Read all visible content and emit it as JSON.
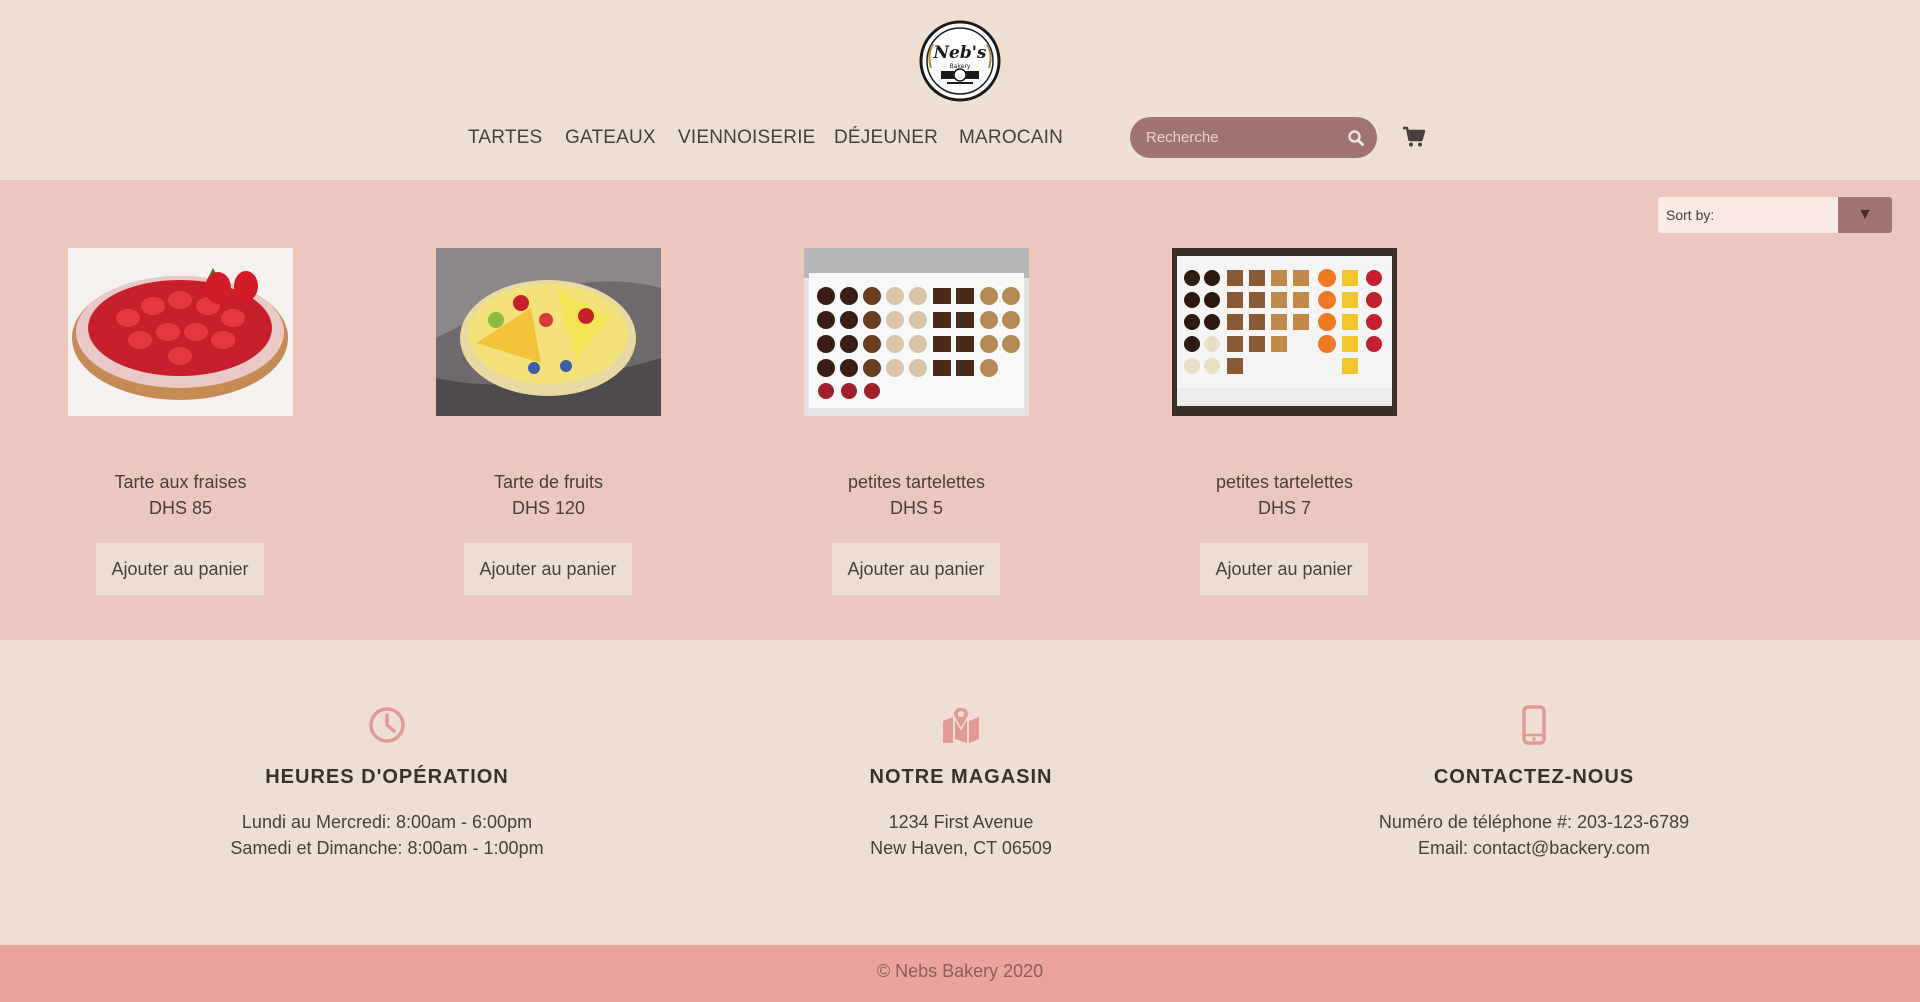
{
  "header": {
    "logo_text": "Neb's Bakery",
    "nav": [
      {
        "label": "TARTES"
      },
      {
        "label": "GATEAUX"
      },
      {
        "label": "VIENNOISERIE"
      },
      {
        "label": "DÉJEUNER"
      },
      {
        "label": "MAROCAIN"
      }
    ],
    "search": {
      "placeholder": "Recherche",
      "value": ""
    },
    "icons": {
      "search": "search-icon",
      "cart": "cart-icon"
    }
  },
  "sort": {
    "label": "Sort by:",
    "arrow": "▼"
  },
  "products": [
    {
      "name": "Tarte aux fraises",
      "price": "DHS 85",
      "button": "Ajouter au panier",
      "image": "strawberry-tart"
    },
    {
      "name": "Tarte de fruits",
      "price": "DHS 120",
      "button": "Ajouter au panier",
      "image": "fruit-tart"
    },
    {
      "name": "petites tartelettes",
      "price": "DHS 5",
      "button": "Ajouter au panier",
      "image": "small-tartlets-tray"
    },
    {
      "name": "petites tartelettes",
      "price": "DHS 7",
      "button": "Ajouter au panier",
      "image": "small-tartlets-tray-2"
    }
  ],
  "info": [
    {
      "icon": "clock-icon",
      "title": "HEURES D'OPÉRATION",
      "line1": "Lundi au Mercredi: 8:00am - 6:00pm",
      "line2": "Samedi et Dimanche: 8:00am - 1:00pm"
    },
    {
      "icon": "map-pin-icon",
      "title": "NOTRE MAGASIN",
      "line1": "1234 First Avenue",
      "line2": "New Haven, CT 06509"
    },
    {
      "icon": "phone-icon",
      "title": "CONTACTEZ-NOUS",
      "line1": "Numéro de téléphone #: 203-123-6789",
      "line2": "Email: contact@backery.com"
    }
  ],
  "footer": {
    "text": "© Nebs Bakery 2020"
  },
  "colors": {
    "background": "#efdfd3",
    "products_band": "#edc6be",
    "accent": "#a07470",
    "icon_pink": "#e49a94",
    "footer": "#eba39d"
  }
}
